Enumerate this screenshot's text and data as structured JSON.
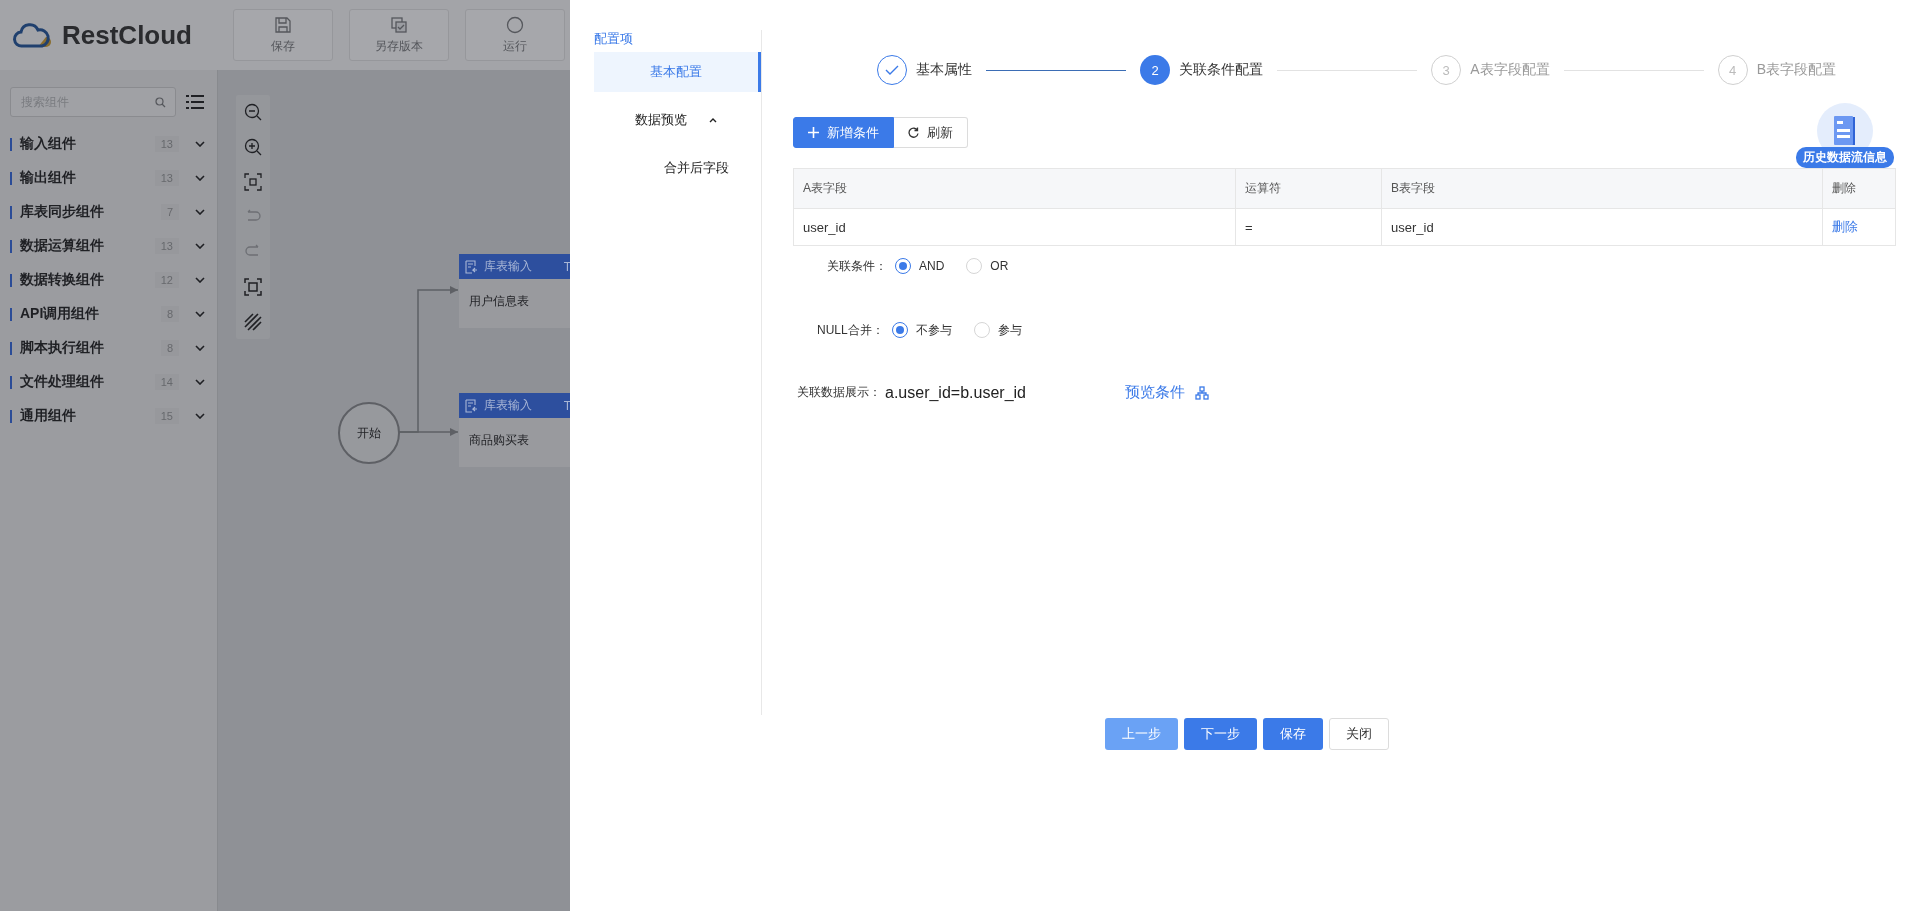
{
  "app": {
    "logo": "RestCloud",
    "toolbar": [
      {
        "kind": "save",
        "label": "保存"
      },
      {
        "kind": "save_as",
        "label": "另存版本"
      },
      {
        "kind": "run",
        "label": "运行"
      }
    ]
  },
  "sidebar": {
    "search": {
      "placeholder": "搜索组件"
    },
    "categories": [
      {
        "label": "输入组件",
        "count": "13",
        "expanded": false
      },
      {
        "label": "输出组件",
        "count": "13",
        "expanded": false
      },
      {
        "label": "库表同步组件",
        "count": "7",
        "expanded": false
      },
      {
        "label": "数据运算组件",
        "count": "13",
        "expanded": false
      },
      {
        "label": "数据转换组件",
        "count": "12",
        "expanded": false
      },
      {
        "label": "API调用组件",
        "count": "8",
        "expanded": false
      },
      {
        "label": "脚本执行组件",
        "count": "8",
        "expanded": false
      },
      {
        "label": "文件处理组件",
        "count": "14",
        "expanded": false
      },
      {
        "label": "通用组件",
        "count": "15",
        "expanded": false
      }
    ]
  },
  "canvas": {
    "start_node": "开始",
    "nodes": [
      {
        "type": "库表输入",
        "extra": "T",
        "name": "用户信息表"
      },
      {
        "type": "库表输入",
        "extra": "T",
        "name": "商品购买表"
      }
    ]
  },
  "drawer": {
    "nav_title": "配置项",
    "nav": [
      {
        "label": "基本配置",
        "selected": true
      },
      {
        "label": "数据预览",
        "selected": false,
        "expanded": true,
        "children": [
          {
            "label": "合并后字段",
            "selected": false
          }
        ]
      }
    ],
    "steps": [
      {
        "label": "基本属性",
        "completed": true,
        "selected": false
      },
      {
        "number": "2",
        "label": "关联条件配置",
        "completed": false,
        "selected": true
      },
      {
        "number": "3",
        "label": "A表字段配置",
        "completed": false,
        "selected": false
      },
      {
        "number": "4",
        "label": "B表字段配置",
        "completed": false,
        "selected": false
      }
    ],
    "actions": [
      {
        "kind": "primary",
        "label": "新增条件"
      },
      {
        "kind": "default",
        "label": "刷新"
      }
    ],
    "table": {
      "columns": [
        "A表字段",
        "运算符",
        "B表字段",
        "删除"
      ],
      "rows": [
        {
          "a_field": "user_id",
          "operator": "=",
          "b_field": "user_id",
          "action": "删除"
        }
      ]
    },
    "history_badge": "历史数据流信息",
    "join_condition": {
      "label": "关联条件：",
      "options": [
        {
          "label": "AND",
          "selected": true
        },
        {
          "label": "OR",
          "selected": false
        }
      ]
    },
    "null_merge": {
      "label": "NULL合并：",
      "options": [
        {
          "label": "不参与",
          "selected": true
        },
        {
          "label": "参与",
          "selected": false
        }
      ]
    },
    "preview": {
      "label": "关联数据展示：",
      "value": "a.user_id=b.user_id",
      "link": "预览条件"
    },
    "footer_buttons": [
      {
        "kind": "light",
        "label": "上一步"
      },
      {
        "kind": "primary",
        "label": "下一步"
      },
      {
        "kind": "primary",
        "label": "保存"
      },
      {
        "kind": "default",
        "label": "关闭"
      }
    ]
  }
}
